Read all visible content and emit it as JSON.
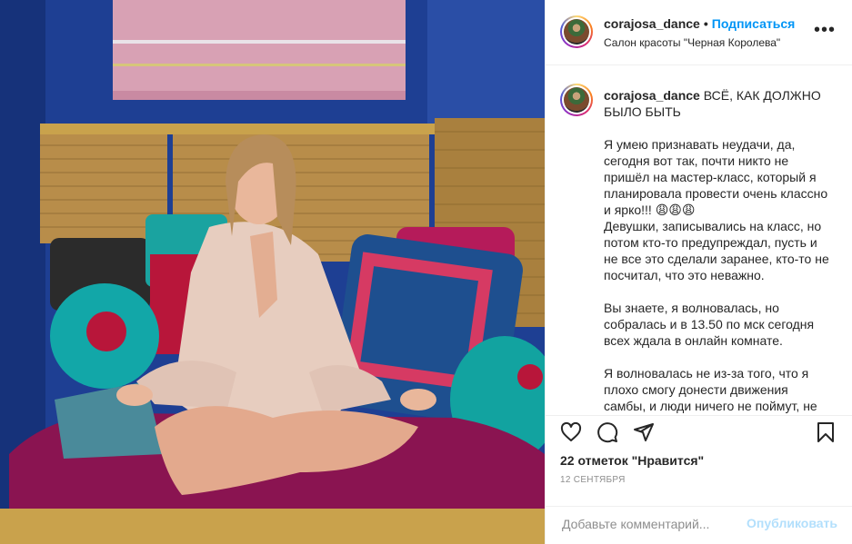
{
  "post": {
    "photo_alt": "",
    "header": {
      "username": "corajosa_dance",
      "separator": "•",
      "follow_label": "Подписаться",
      "location": "Салон красоты \"Черная Королева\"",
      "more_icon": "more-horizontal-icon"
    },
    "caption": {
      "username": "corajosa_dance",
      "title": "ВСЁ, КАК ДОЛЖНО БЫЛО БЫТЬ",
      "body": "Я умею признавать неудачи, да, сегодня вот так, почти никто не пришёл на мастер-класс, который я планировала провести очень классно и ярко!!! 😩😩😩\nДевушки, записывались на класс, но потом кто-то предупреждал, пусть и не все это сделали заранее, кто-то не посчитал, что это неважно.\n\nВы знаете, я волновалась, но собралась и в 13.50 по мск сегодня всех ждала в онлайн комнате.\n\nЯ волновалась не из-за того, что я плохо смогу донести движения самбы, и люди ничего не поймут, не"
    },
    "actions": {
      "like_icon": "heart-icon",
      "comment_icon": "comment-icon",
      "share_icon": "share-icon",
      "save_icon": "bookmark-icon"
    },
    "likes_text": "22 отметок \"Нравится\"",
    "date_text": "12 сентября",
    "comment": {
      "placeholder": "Добавьте комментарий...",
      "post_label": "Опубликовать"
    },
    "colors": {
      "accent": "#0095f6",
      "post_disabled": "#b2dffc",
      "muted": "#8e8e8e",
      "border": "#efefef"
    }
  }
}
